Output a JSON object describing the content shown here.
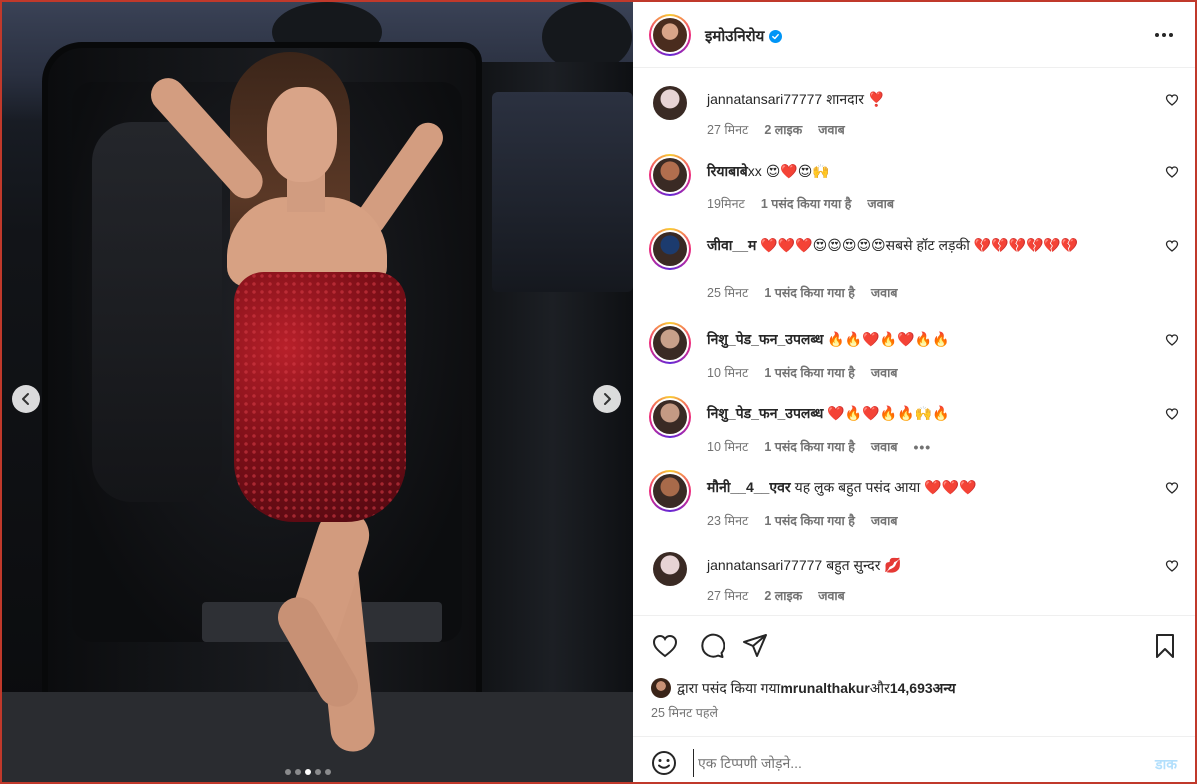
{
  "post": {
    "author": "इमोउनिरोय",
    "more_icon": "more-horizontal-icon",
    "dot_count": 5,
    "active_dot": 3
  },
  "comments": [
    {
      "user": "jannatansari77777",
      "user_bold": false,
      "text": "शानदार ❣️",
      "time": "27 मिनट",
      "likes": "2 लाइक",
      "reply": "जवाब",
      "story_ring": false,
      "avatar_color": "#e7d3d4"
    },
    {
      "user": "रियाबाबे",
      "user_suffix": "xx",
      "user_bold": true,
      "text": "😍❤️😍🙌",
      "time": "19मिनट",
      "likes": "1 पसंद किया गया है",
      "reply": "जवाब",
      "story_ring": true,
      "avatar_color": "#b26e4e"
    },
    {
      "user": "जीवा__म",
      "user_bold": true,
      "text": "❤️❤️❤️😍😍😍😍😍सबसे हॉट लड़की 💔💔💔💔💔💔",
      "time": "25 मिनट",
      "likes": "1 पसंद किया गया है",
      "reply": "जवाब",
      "story_ring": true,
      "avatar_color": "#1c3b6e"
    },
    {
      "user": "निशु_पेड_फन_उपलब्ध",
      "user_bold": true,
      "text": "🔥🔥❤️🔥❤️🔥🔥",
      "time": "10 मिनट",
      "likes": "1 पसंद किया गया है",
      "reply": "जवाब",
      "story_ring": true,
      "avatar_color": "#c8a08a"
    },
    {
      "user": "निशु_पेड_फन_उपलब्ध",
      "user_bold": true,
      "text": "❤️🔥❤️🔥🔥🙌🔥",
      "time": "10 मिनट",
      "likes": "1 पसंद किया गया है",
      "reply": "जवाब",
      "story_ring": true,
      "avatar_color": "#c49a84",
      "more": "•••"
    },
    {
      "user": "मौनी__4__एवर",
      "user_bold": true,
      "text": "यह लुक बहुत पसंद आया ❤️❤️❤️",
      "time": "23 मिनट",
      "likes": "1 पसंद किया गया है",
      "reply": "जवाब",
      "story_ring": true,
      "avatar_color": "#a86a4a"
    },
    {
      "user": "jannatansari77777",
      "user_bold": false,
      "text": "बहुत सुन्दर 💋",
      "time": "27 मिनट",
      "likes": "2 लाइक",
      "reply": "जवाब",
      "story_ring": false,
      "avatar_color": "#e7d3d4"
    }
  ],
  "actions": {
    "like_icon": "heart-icon",
    "comment_icon": "comment-icon",
    "share_icon": "send-icon",
    "save_icon": "bookmark-icon"
  },
  "likes_line": {
    "prefix": "द्वारा पसंद किया गया",
    "user": "mrunalthakur",
    "middle": "और ",
    "count": "14,693",
    "suffix": " अन्य"
  },
  "posted_time": "25 मिनट पहले",
  "add_comment": {
    "placeholder": "एक टिप्पणी जोड़ने...",
    "post_label": "डाक",
    "emoji_icon": "smiley-icon"
  },
  "colors": {
    "accent_blue": "#0095f6",
    "post_disabled": "#b2dffc",
    "meta_gray": "#737373",
    "heart_red": "#ed4956"
  }
}
